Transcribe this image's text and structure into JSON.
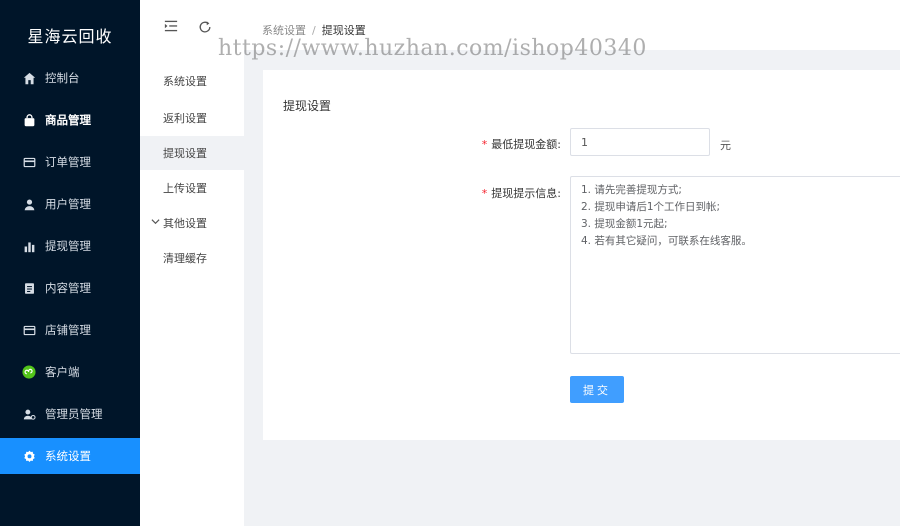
{
  "brand": "星海云回收",
  "sidebar": {
    "items": [
      {
        "label": "控制台",
        "icon": "home-icon"
      },
      {
        "label": "商品管理",
        "icon": "bag-icon"
      },
      {
        "label": "订单管理",
        "icon": "card-icon"
      },
      {
        "label": "用户管理",
        "icon": "user-icon"
      },
      {
        "label": "提现管理",
        "icon": "bar-chart-icon"
      },
      {
        "label": "内容管理",
        "icon": "document-icon"
      },
      {
        "label": "店铺管理",
        "icon": "store-icon"
      },
      {
        "label": "客户端",
        "icon": "mini-program-icon"
      },
      {
        "label": "管理员管理",
        "icon": "admin-icon"
      },
      {
        "label": "系统设置",
        "icon": "gear-icon"
      }
    ],
    "active_index": 9
  },
  "submenu": {
    "items": [
      {
        "label": "系统设置"
      },
      {
        "label": "返利设置"
      },
      {
        "label": "提现设置"
      },
      {
        "label": "上传设置"
      },
      {
        "label": "其他设置",
        "group": true
      },
      {
        "label": "清理缓存"
      }
    ],
    "active_index": 2
  },
  "topbar": {
    "collapse_icon": "collapse-menu-icon",
    "refresh_icon": "refresh-icon",
    "breadcrumb": [
      "系统设置",
      "提现设置"
    ],
    "separator": "/"
  },
  "watermark": "https://www.huzhan.com/ishop40340",
  "form": {
    "title": "提现设置",
    "min_amount": {
      "label": "最低提现金额:",
      "value": "1",
      "unit": "元"
    },
    "tip": {
      "label": "提现提示信息:",
      "lines": [
        "1. 请先完善提现方式;",
        "2. 提现申请后1个工作日到帐;",
        "3. 提现金额1元起;",
        "4. 若有其它疑问，可联系在线客服。"
      ]
    },
    "submit_label": "提交"
  },
  "colors": {
    "sidebar_bg": "#001529",
    "active_blue": "#1890ff",
    "button_blue": "#409eff",
    "required": "#f5222d"
  }
}
